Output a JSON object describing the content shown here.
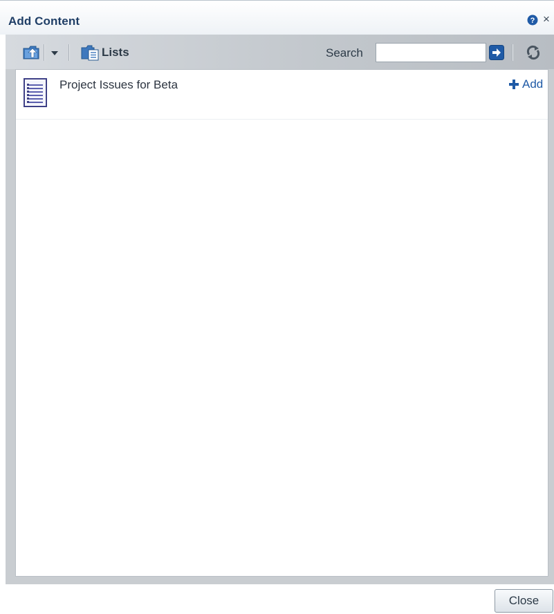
{
  "dialog": {
    "title": "Add Content",
    "help_icon": "help-icon",
    "close_icon": "close-icon",
    "close_symbol": "×"
  },
  "toolbar": {
    "up_icon": "folder-up-icon",
    "dropdown_icon": "chevron-down-icon",
    "lists_icon": "lists-folder-icon",
    "lists_label": "Lists",
    "search_label": "Search",
    "search_value": "",
    "search_go_icon": "arrow-right-icon",
    "refresh_icon": "refresh-icon"
  },
  "items": [
    {
      "title": "Project Issues for Beta",
      "icon": "list-document-icon",
      "action_icon": "plus-icon",
      "action_label": "Add"
    }
  ],
  "footer": {
    "close_label": "Close"
  },
  "colors": {
    "title": "#1f3e66",
    "link": "#1f5aa6",
    "toolbar": "#c9cdd1",
    "accent_blue": "#1f5aa6"
  }
}
